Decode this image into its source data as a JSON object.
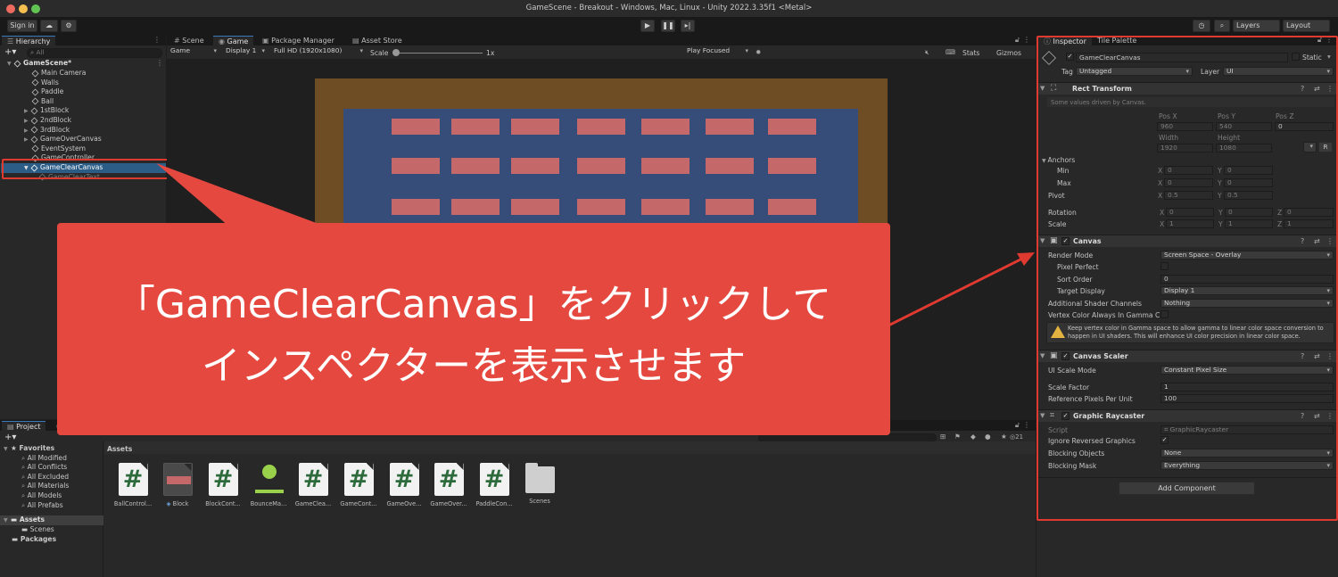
{
  "window": {
    "title": "GameScene - Breakout - Windows, Mac, Linux - Unity 2022.3.35f1 <Metal>"
  },
  "toolbar": {
    "sign_in": "Sign in",
    "layers": "Layers",
    "layout": "Layout"
  },
  "hierarchy": {
    "tab": "Hierarchy",
    "search_placeholder": "All",
    "scene": "GameScene*",
    "items": [
      {
        "label": "Main Camera"
      },
      {
        "label": "Walls"
      },
      {
        "label": "Paddle"
      },
      {
        "label": "Ball"
      },
      {
        "label": "1stBlock"
      },
      {
        "label": "2ndBlock"
      },
      {
        "label": "3rdBlock"
      },
      {
        "label": "GameOverCanvas"
      },
      {
        "label": "EventSystem"
      },
      {
        "label": "GameController"
      },
      {
        "label": "GameClearCanvas"
      },
      {
        "label": "GameClearText"
      }
    ]
  },
  "center_tabs": [
    "Scene",
    "Game",
    "Package Manager",
    "Asset Store"
  ],
  "game_toolbar": {
    "mode": "Game",
    "display": "Display 1",
    "resolution": "Full HD (1920x1080)",
    "scale_label": "Scale",
    "scale_value": "1x",
    "play_focused": "Play Focused",
    "stats": "Stats",
    "gizmos": "Gizmos"
  },
  "colors": {
    "accent": "#3a79bb",
    "outer_frame": "#6e4d24",
    "play_area": "#374d79",
    "brick": "#c4686a",
    "callout": "#e5483f",
    "highlight_border": "#e03a30"
  },
  "project": {
    "tabs": [
      "Project",
      "Console"
    ],
    "favorites_label": "Favorites",
    "favorites": [
      "All Modified",
      "All Conflicts",
      "All Excluded",
      "All Materials",
      "All Models",
      "All Prefabs"
    ],
    "assets_label": "Assets",
    "assets_children": [
      "Scenes"
    ],
    "packages_label": "Packages",
    "breadcrumb": "Assets",
    "count_badge": "21",
    "assets": [
      {
        "name": "BallControl...",
        "icon": "script-icon"
      },
      {
        "name": "Block",
        "icon": "prefab-icon"
      },
      {
        "name": "BlockCont...",
        "icon": "script-icon"
      },
      {
        "name": "BounceMa...",
        "icon": "physics-material-icon"
      },
      {
        "name": "GameClea...",
        "icon": "script-icon"
      },
      {
        "name": "GameCont...",
        "icon": "script-icon"
      },
      {
        "name": "GameOve...",
        "icon": "script-icon"
      },
      {
        "name": "GameOver...",
        "icon": "script-icon"
      },
      {
        "name": "PaddleCon...",
        "icon": "script-icon"
      },
      {
        "name": "Scenes",
        "icon": "folder-icon"
      }
    ]
  },
  "inspector": {
    "tabs": [
      "Inspector",
      "Tile Palette"
    ],
    "object_name": "GameClearCanvas",
    "static_label": "Static",
    "tag_label": "Tag",
    "tag_value": "Untagged",
    "layer_label": "Layer",
    "layer_value": "UI",
    "rect_transform": {
      "title": "Rect Transform",
      "note": "Some values driven by Canvas.",
      "pos_x_label": "Pos X",
      "pos_y_label": "Pos Y",
      "pos_z_label": "Pos Z",
      "pos_x": "960",
      "pos_y": "540",
      "pos_z": "0",
      "width_label": "Width",
      "height_label": "Height",
      "width": "1920",
      "height": "1080",
      "anchors_label": "Anchors",
      "min_label": "Min",
      "max_label": "Max",
      "pivot_label": "Pivot",
      "rotation_label": "Rotation",
      "scale_label": "Scale",
      "x_label": "X",
      "y_label": "Y",
      "z_label": "Z",
      "anchor_min_x": "0",
      "anchor_min_y": "0",
      "anchor_max_x": "0",
      "anchor_max_y": "0",
      "pivot_x": "0.5",
      "pivot_y": "0.5",
      "rot_x": "0",
      "rot_y": "0",
      "rot_z": "0",
      "scale_x": "1",
      "scale_y": "1",
      "scale_z": "1",
      "r_button": "R"
    },
    "canvas": {
      "title": "Canvas",
      "render_mode_label": "Render Mode",
      "render_mode": "Screen Space - Overlay",
      "pixel_perfect_label": "Pixel Perfect",
      "sort_order_label": "Sort Order",
      "sort_order": "0",
      "target_display_label": "Target Display",
      "target_display": "Display 1",
      "shader_channels_label": "Additional Shader Channels",
      "shader_channels": "Nothing",
      "vertex_color_label": "Vertex Color Always In Gamma C",
      "warning_line1": "Keep vertex color in Gamma space to allow gamma to linear color space conversion to",
      "warning_line2": "happen in UI shaders. This will enhance UI color precision in linear color space."
    },
    "canvas_scaler": {
      "title": "Canvas Scaler",
      "ui_scale_mode_label": "UI Scale Mode",
      "ui_scale_mode": "Constant Pixel Size",
      "scale_factor_label": "Scale Factor",
      "scale_factor": "1",
      "ref_ppu_label": "Reference Pixels Per Unit",
      "ref_ppu": "100"
    },
    "graphic_raycaster": {
      "title": "Graphic Raycaster",
      "script_label": "Script",
      "script_value": "GraphicRaycaster",
      "ignore_reversed_label": "Ignore Reversed Graphics",
      "blocking_objects_label": "Blocking Objects",
      "blocking_objects": "None",
      "blocking_mask_label": "Blocking Mask",
      "blocking_mask": "Everything"
    },
    "add_component": "Add Component"
  },
  "callout": {
    "line1": "「GameClearCanvas」をクリックして",
    "line2": "インスペクターを表示させます"
  }
}
